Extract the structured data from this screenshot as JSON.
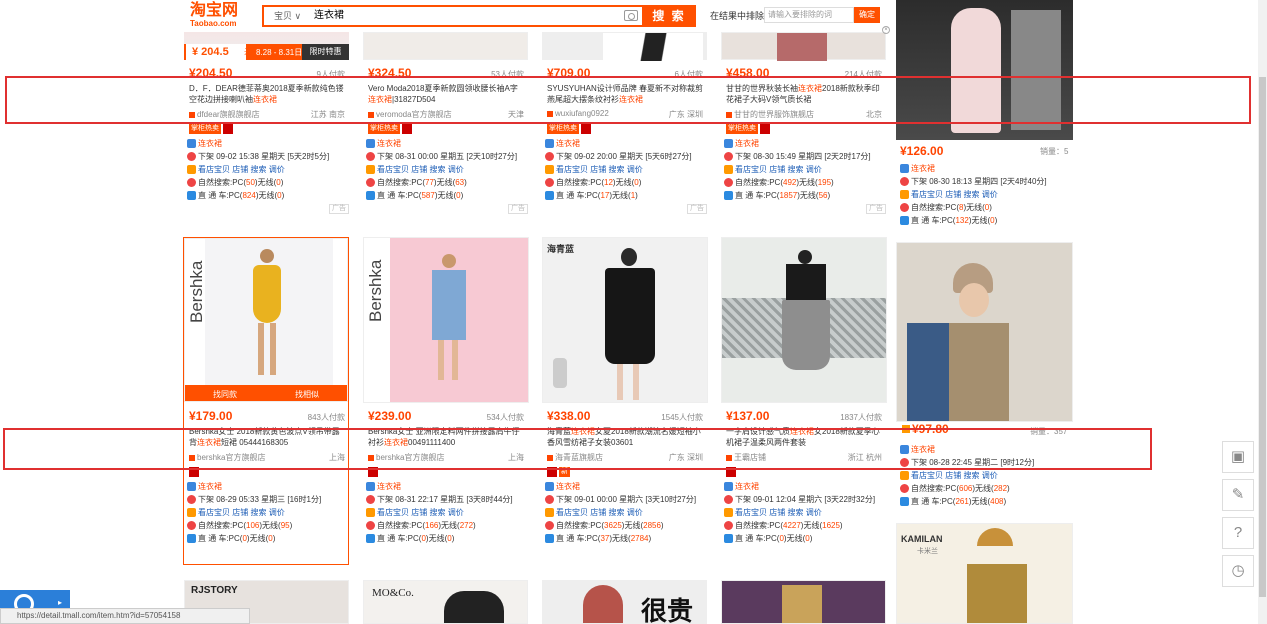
{
  "header": {
    "logo": "淘宝网",
    "logo_sub": "Taobao.com",
    "search_scope": "宝贝 ∨",
    "search_query": "连衣裙",
    "search_button": "搜 索",
    "exclude_label": "在结果中排除",
    "exclude_placeholder": "请输入要排除的词",
    "exclude_button": "确定",
    "close": "×"
  },
  "promo": {
    "price": "¥ 204.5",
    "price_unit": "元",
    "dates": "8.28 - 8.31日",
    "label": "限时特惠"
  },
  "row1": [
    {
      "price": "¥204.50",
      "sales": "9人付款",
      "title_pre": "D．F．DEAR德菲蒂奥2018夏季新款纯色镂空花边拼接喇叭袖",
      "hl": "连衣裙",
      "title_post": "",
      "shop": "dfdear旗舰旗舰店",
      "loc": "江苏 南京",
      "pc": "50",
      "wx": "0",
      "ztc_pc": "824",
      "ztc_wx": "0",
      "time": "下架 09-02 15:38 星期天 [5天2时5分]"
    },
    {
      "price": "¥324.50",
      "sales": "53人付款",
      "title_pre": "Vero Moda2018夏季新款圆领收腰长袖A字",
      "hl": "连衣裙",
      "title_post": "|31827D504",
      "shop": "veromoda官方旗舰店",
      "loc": "天津",
      "pc": "77",
      "wx": "63",
      "ztc_pc": "587",
      "ztc_wx": "0",
      "time": "下架 08-31 00:00 星期五 [2天10时27分]"
    },
    {
      "price": "¥709.00",
      "sales": "6人付款",
      "title_pre": "SYUSYUHAN设计师品牌 春夏新不对称裁剪燕尾超大摆条纹衬衫",
      "hl": "连衣裙",
      "title_post": "",
      "shop": "wuxiufang0922",
      "loc": "广东 深圳",
      "pc": "12",
      "wx": "0",
      "ztc_pc": "17",
      "ztc_wx": "1",
      "time": "下架 09-02 20:00 星期天 [5天6时27分]"
    },
    {
      "price": "¥458.00",
      "sales": "214人付款",
      "title_pre": "甘甘的世界秋装长袖",
      "hl": "连衣裙",
      "title_post": "2018新款秋季印花裙子大码V领气质长裙",
      "shop": "甘甘的世界服饰旗舰店",
      "loc": "北京",
      "pc": "492",
      "wx": "195",
      "ztc_pc": "1857",
      "ztc_wx": "56",
      "time": "下架 08-30 15:49 星期四 [2天2时17分]"
    }
  ],
  "side1": {
    "price": "¥126.00",
    "sales": "销量：5",
    "kw": "连衣裙",
    "time": "下架 08-30 18:13 星期四 [2天4时40分]",
    "pc": "8",
    "wx": "0",
    "ztc_pc": "132",
    "ztc_wx": "0"
  },
  "row2": [
    {
      "price": "¥179.00",
      "sales": "843人付款",
      "title_pre": "Bershka女士 2018新款黄色波点V领吊带露背",
      "hl": "连衣裙",
      "title_post": "短裙 05444168305",
      "shop": "bershka官方旗舰店",
      "loc": "上海",
      "pc": "106",
      "wx": "95",
      "ztc_pc": "0",
      "ztc_wx": "0",
      "time": "下架 08-29 05:33 星期三 [16时1分]",
      "hover_a": "找同款",
      "hover_b": "找相似",
      "brand": "Bershka"
    },
    {
      "price": "¥239.00",
      "sales": "534人付款",
      "title_pre": "Bershka女士 亚洲限定料两件拼接露肩牛仔衬衫",
      "hl": "连衣裙",
      "title_post": "00491111400",
      "shop": "bershka官方旗舰店",
      "loc": "上海",
      "pc": "166",
      "wx": "272",
      "ztc_pc": "0",
      "ztc_wx": "0",
      "time": "下架 08-31 22:17 星期五 [3天8时44分]",
      "brand": "Bershka"
    },
    {
      "price": "¥338.00",
      "sales": "1545人付款",
      "title_pre": "海青蓝",
      "hl": "连衣裙",
      "title_post": "女夏2018新款潮流名媛短袖小香风雪纺裙子女装03601",
      "shop": "海青蓝旗舰店",
      "loc": "广东 深圳",
      "pc": "3625",
      "wx": "2856",
      "ztc_pc": "37",
      "ztc_wx": "2784",
      "time": "下架 09-01 00:00 星期六 [3天10时27分]",
      "brand_tag": "海青蓝"
    },
    {
      "price": "¥137.00",
      "sales": "1837人付款",
      "title_pre": "一字肩设计感气质",
      "hl": "连衣裙",
      "title_post": "女2018新款夏季心机裙子温柔风两件套装",
      "shop": "王霸店铺",
      "loc": "浙江 杭州",
      "pc": "4227",
      "wx": "1625",
      "ztc_pc": "0",
      "ztc_wx": "0",
      "time": "下架 09-01 12:04 星期六 [3天22时32分]"
    }
  ],
  "side2": {
    "price": "¥97.80",
    "sales": "销量：357",
    "kw": "连衣裙",
    "time": "下架 08-28 22:45 星期二 [9时12分]",
    "pc": "606",
    "wx": "282",
    "ztc_pc": "261",
    "ztc_wx": "408"
  },
  "row3": {
    "b1": "RJSTORY",
    "b2": "MO&Co.",
    "b3": "很贵",
    "b4": "KAMILAN",
    "b4_sub": "卡米兰"
  },
  "labels": {
    "hot": "掌柜热卖",
    "kw": "连衣裙",
    "view": "看店宝贝",
    "shop_rec": "店铺",
    "search": "搜索",
    "adjust": "调价",
    "natural": "自然搜索:PC(",
    "wx": ")无线(",
    "close_paren": ")",
    "ztc": "直 通 车:PC(",
    "ad": "广告",
    "new": "新"
  },
  "status_url": "https://detail.tmall.com/item.htm?id=57054158",
  "side_tools": [
    "gift-icon",
    "edit-icon",
    "help-icon",
    "clock-icon"
  ]
}
